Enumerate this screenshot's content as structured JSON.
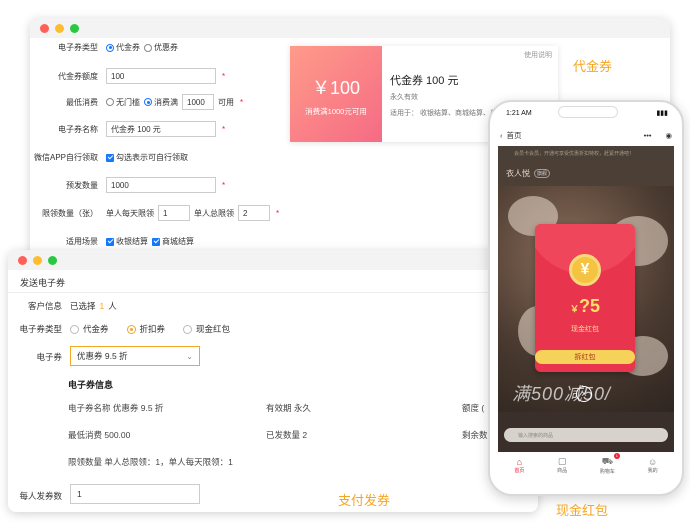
{
  "back_form": {
    "type_label": "电子券类型",
    "type_options": [
      "代金券",
      "优惠券"
    ],
    "amount_label": "代金券额度",
    "amount_value": "100",
    "min_label": "最低消费",
    "min_options": [
      "无门槛",
      "消费满"
    ],
    "min_value": "1000",
    "min_suffix": "可用",
    "name_label": "电子券名称",
    "name_value": "代金券 100 元",
    "wechat_label": "微信APP自行领取",
    "wechat_check": "勾选表示可自行领取",
    "issue_label": "预发数量",
    "issue_value": "1000",
    "limit_label": "限领数量（张）",
    "limit_daily_label": "单人每天限领",
    "limit_daily_value": "1",
    "limit_total_label": "单人总限领",
    "limit_total_value": "2",
    "scene_label": "适用场景",
    "scene_options": [
      "收银结算",
      "商城结算"
    ]
  },
  "coupon_preview": {
    "help": "使用说明",
    "amount": "￥100",
    "condition": "消费满1000元可用",
    "name": "代金券 100 元",
    "validity": "永久有效",
    "scope": "适用于：  收银结算、商城结算、美店…"
  },
  "labels": {
    "voucher": "代金券",
    "pay_issue": "支付发券",
    "red_packet": "现金红包"
  },
  "front_form": {
    "title": "发送电子券",
    "customer_label": "客户信息",
    "customer_prefix": "已选择",
    "customer_count": "1",
    "customer_suffix": "人",
    "type_label": "电子券类型",
    "type_options": [
      "代金券",
      "折扣券",
      "现金红包"
    ],
    "coupon_label": "电子券",
    "coupon_value": "优惠券 9.5 折",
    "info_title": "电子券信息",
    "info_name": "电子券名称 优惠券 9.5 折",
    "info_valid": "有效期 永久",
    "info_quota": "额度 (",
    "info_min": "最低消费 500.00",
    "info_issued": "已发数量 2",
    "info_remain": "剩余数",
    "info_limit": "限领数量 单人总限领：1，单人每天限领：1",
    "per_label": "每人发券数",
    "per_value": "1"
  },
  "phone": {
    "time": "1:21 AM",
    "home": "首页",
    "notice": "会员卡会员，开通可享受优惠折扣特权，赶紧开通吧！",
    "store": "衣人悦",
    "store_tag": "旗舰",
    "bigtext": "满500减50/",
    "search": "输入搜索的商品",
    "rp_currency": "￥",
    "rp_amount": "?5",
    "rp_label": "现金红包",
    "rp_button": "拆红包",
    "tabs": [
      "首页",
      "商品",
      "购物车",
      "我的"
    ],
    "cart_badge": "1"
  }
}
